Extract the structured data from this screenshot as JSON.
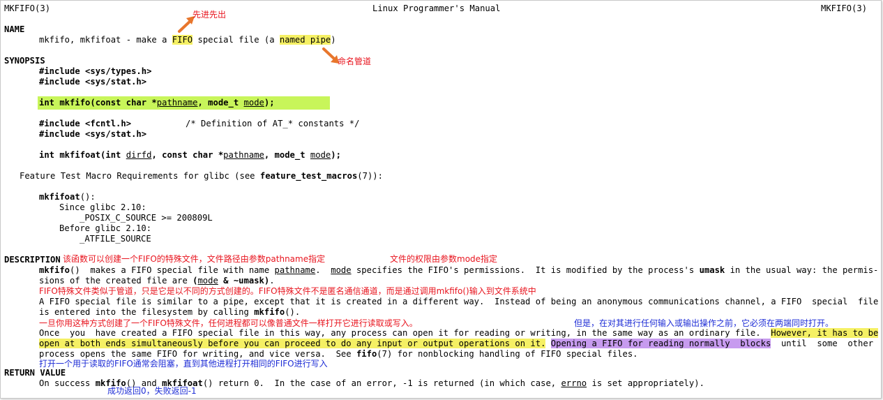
{
  "header": {
    "left": "MKFIFO(3)",
    "center": "Linux Programmer's Manual",
    "right": "MKFIFO(3)"
  },
  "name": {
    "heading": "NAME",
    "p1": "mkfifo, mkfifoat - make a ",
    "fifo": "FIFO",
    "p2": " special file (a ",
    "named_pipe": "named pipe",
    "p3": ")"
  },
  "synopsis": {
    "heading": "SYNOPSIS",
    "inc1": "#include <sys/types.h>",
    "inc2": "#include <sys/stat.h>",
    "proto1": {
      "a": "int mkfifo(const char *",
      "pathname": "pathname",
      "b": ", mode_t ",
      "mode": "mode",
      "c": ");"
    },
    "inc3": "#include <fcntl.h>",
    "inc3_comment": "/* Definition of AT_* constants */",
    "inc4": "#include <sys/stat.h>",
    "proto2": {
      "a": "int mkfifoat(int ",
      "dirfd": "dirfd",
      "b": ", const char *",
      "pathname": "pathname",
      "c": ", mode_t ",
      "mode": "mode",
      "d": ");"
    },
    "ftm": {
      "a": "Feature Test Macro Requirements for glibc (see ",
      "b": "feature_test_macros",
      "c": "(7)):"
    },
    "mkfifoat_fn": "mkfifoat",
    "mkfifoat_paren": "():",
    "since": "Since glibc 2.10:",
    "posix": "_POSIX_C_SOURCE >= 200809L",
    "before": "Before glibc 2.10:",
    "atfile": "_ATFILE_SOURCE"
  },
  "description": {
    "heading": "DESCRIPTION",
    "l1": {
      "fn": "mkfifo",
      "a": "()  makes a FIFO special file with name ",
      "pathname": "pathname",
      "b": ".  ",
      "mode": "mode",
      "c": " specifies the FIFO's permissions.  It is modified by the process's ",
      "umask": "umask",
      "d": " in the usual way: the permis-"
    },
    "l2": {
      "a": "sions of the created file are ",
      "b": "(",
      "mode": "mode",
      "c": " & ~umask)",
      "d": "."
    },
    "l3": "A FIFO special file is similar to a pipe, except that it is created in a different way.  Instead of being an anonymous communications channel, a FIFO  special  file",
    "l4": {
      "a": "is entered into the filesystem by calling ",
      "fn": "mkfifo",
      "b": "()."
    },
    "l5": {
      "a": "Once  you  have created a FIFO special file in this way, any process can open it for reading or writing, in the same way as an ordinary file.  ",
      "hl": "However, it has to be"
    },
    "l6": {
      "hl": "open at both ends simultaneously before you can proceed to do any input or output operations on it.",
      "gap": " ",
      "hl2": "Opening a FIFO for reading normally  blocks",
      "b": "  until  some  other"
    },
    "l7": {
      "a": "process opens the same FIFO for writing, and vice versa.  See ",
      "fn": "fifo",
      "b": "(7) for nonblocking handling of FIFO special files."
    }
  },
  "return_value": {
    "heading": "RETURN VALUE",
    "l1": {
      "a": "On success ",
      "fn1": "mkfifo",
      "b": "() and ",
      "fn2": "mkfifoat",
      "c": "() return 0.  In the case of an error, -1 is returned (in which case, ",
      "errno": "errno",
      "d": " is set appropriately)."
    }
  },
  "annotations": {
    "fifo": "先进先出",
    "named_pipe": "命名管道",
    "desc1": "该函数可以创建一个FIFO的特殊文件，文件路径由参数pathname指定",
    "desc2": "文件的权限由参数mode指定",
    "desc3": "FIFO特殊文件类似于管道，只是它是以不同的方式创建的。FIFO特殊文件不是匿名通信通道，而是通过调用mkfifo()输入到文件系统中",
    "desc4": "一旦你用这种方式创建了一个FIFO特殊文件，任何进程都可以像普通文件一样打开它进行读取或写入。",
    "desc5": "但是，在对其进行任何输入或输出操作之前，它必须在两端同时打开。",
    "desc6": "打开一个用于读取的FIFO通常会阻塞，直到其他进程打开相同的FIFO进行写入",
    "ret": "成功返回0，失败返回-1"
  },
  "colors": {
    "annotation_red": "#e8141e",
    "annotation_blue": "#1e2dd6",
    "highlight_yellow": "#f5f064",
    "highlight_purple": "#c79bef",
    "highlight_green": "#c8f55a",
    "arrow": "#e8762c"
  }
}
